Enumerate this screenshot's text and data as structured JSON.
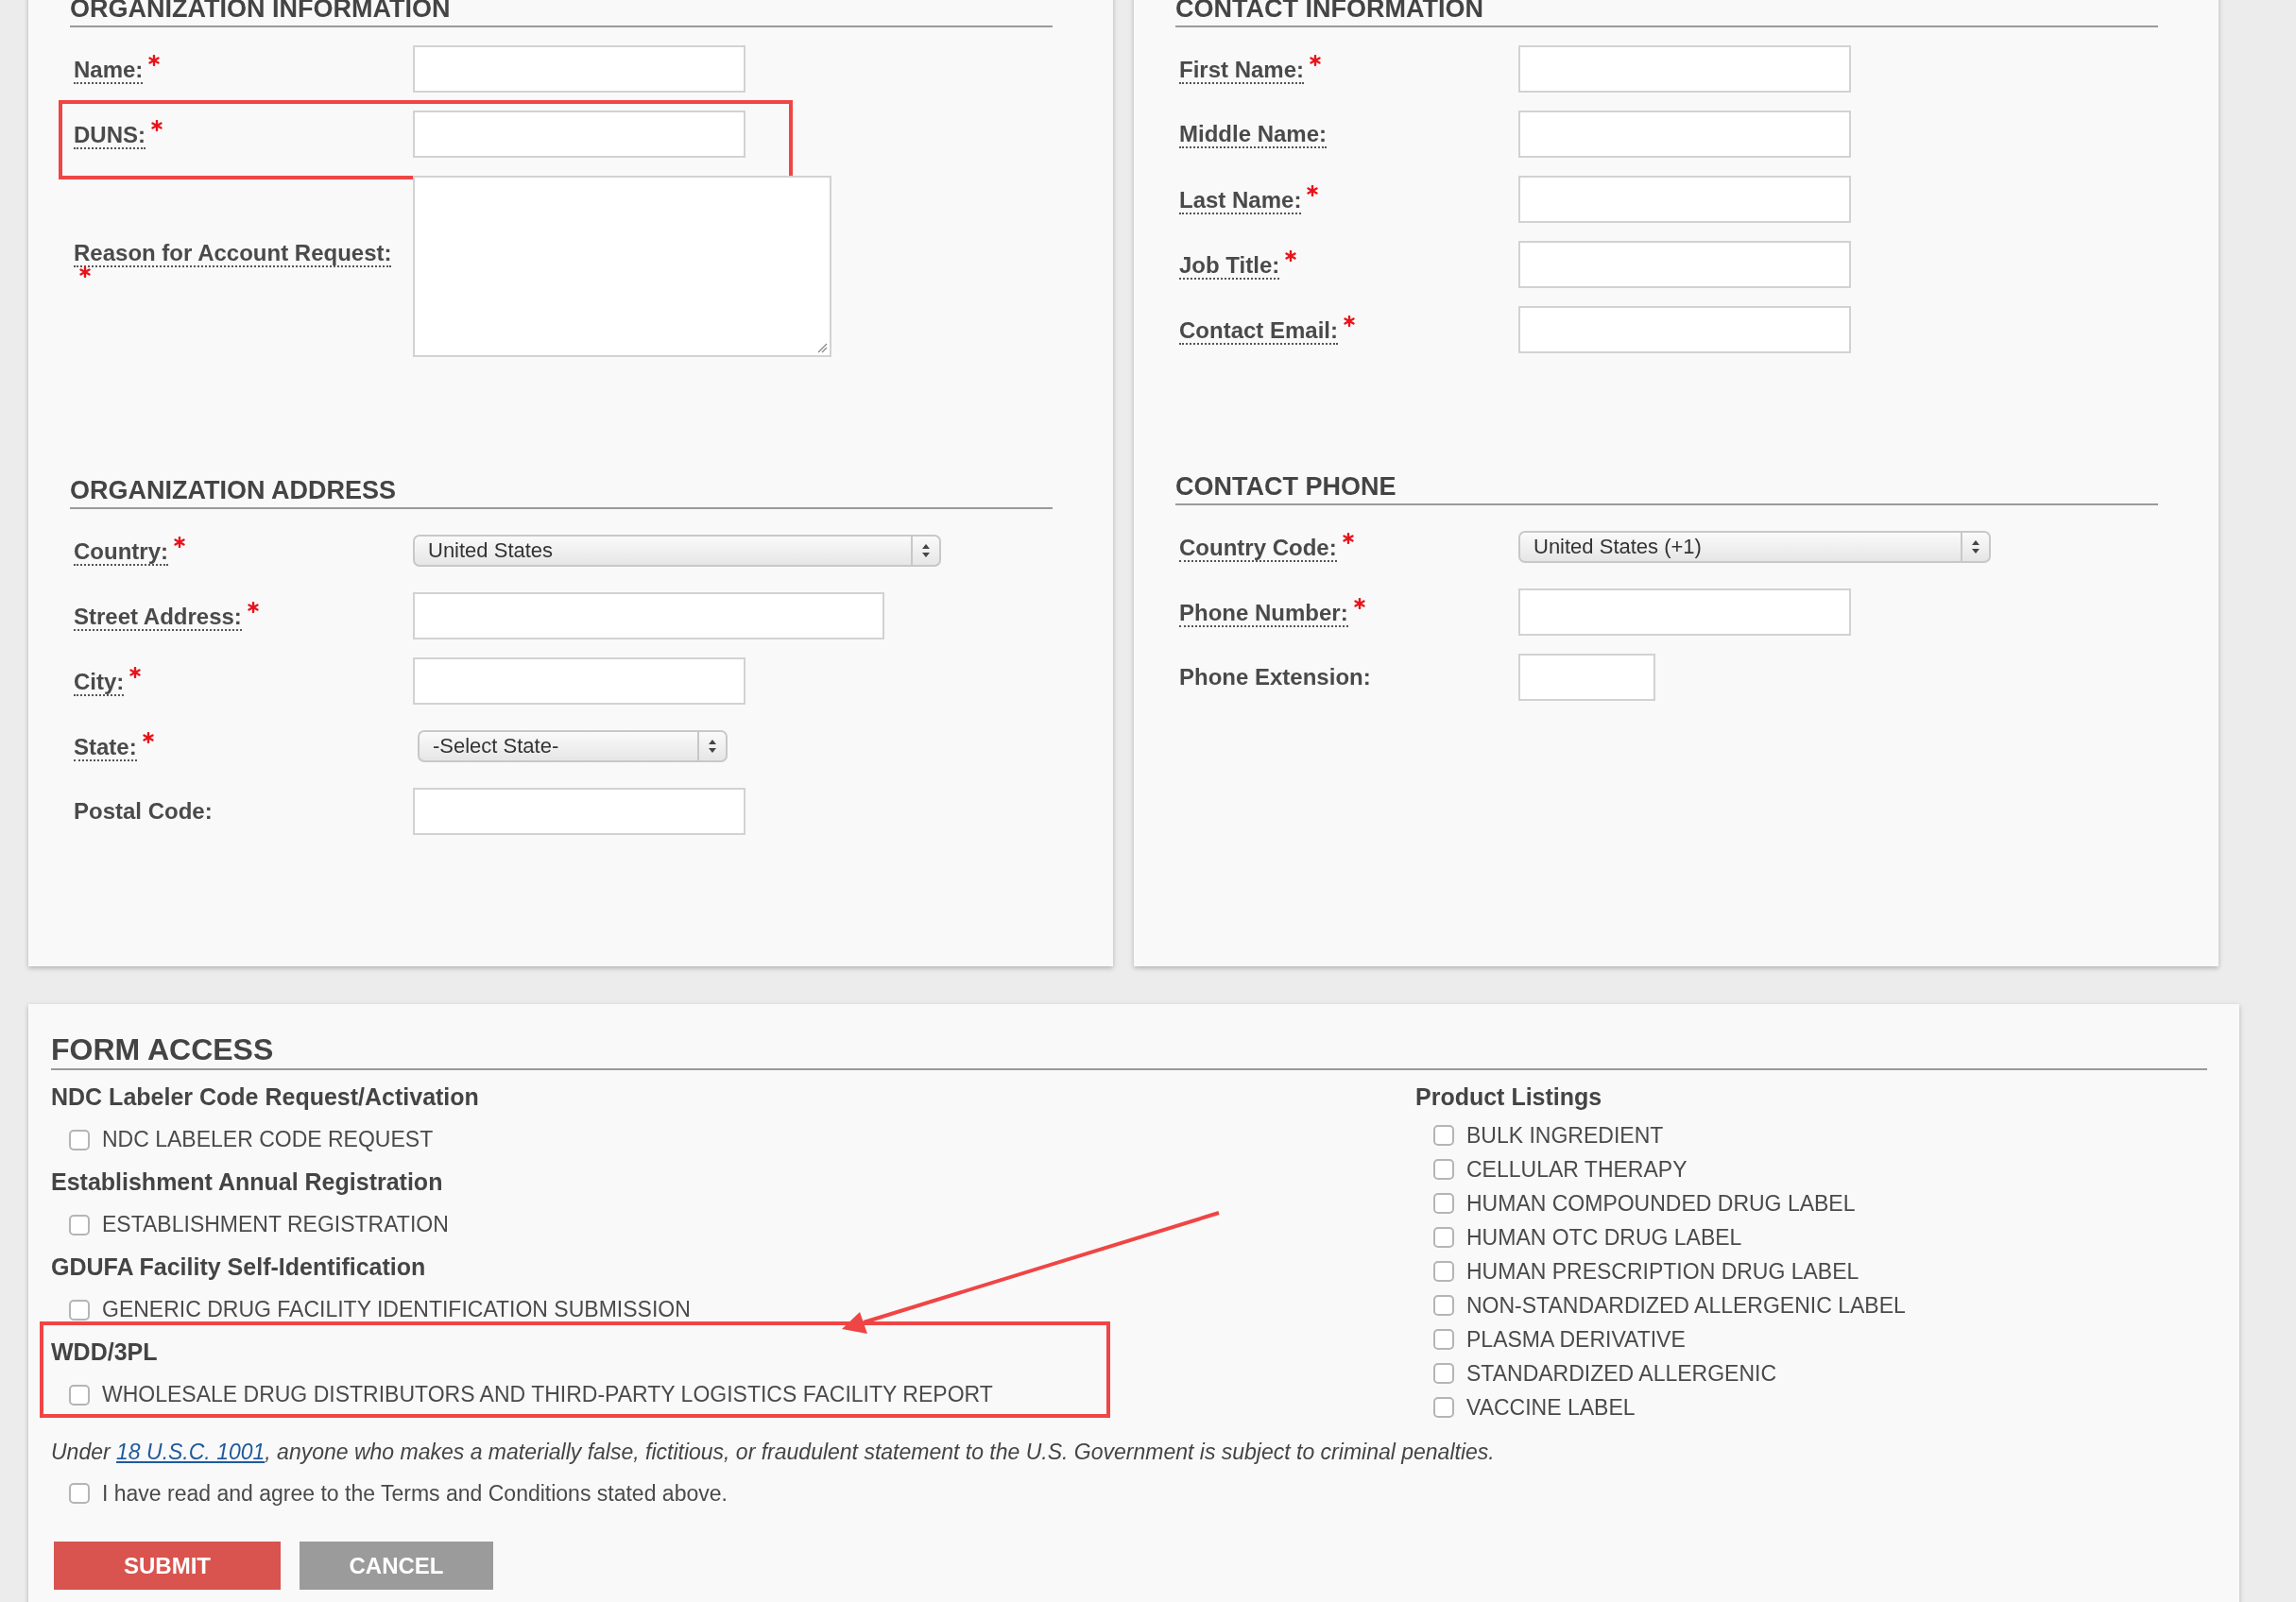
{
  "organization_information": {
    "heading": "ORGANIZATION INFORMATION",
    "fields": [
      {
        "label": "Name:",
        "required": true,
        "help": true,
        "kind": "text",
        "highlighted": false
      },
      {
        "label": "DUNS:",
        "required": true,
        "help": true,
        "kind": "text",
        "highlighted": true
      },
      {
        "label": "Reason for Account Request:",
        "required": true,
        "help": true,
        "kind": "textarea",
        "highlighted": false
      }
    ]
  },
  "organization_address": {
    "heading": "ORGANIZATION ADDRESS",
    "fields": [
      {
        "label": "Country:",
        "required": true,
        "help": true,
        "kind": "select",
        "value": "United States"
      },
      {
        "label": "Street Address:",
        "required": true,
        "help": true,
        "kind": "wide-text"
      },
      {
        "label": "City:",
        "required": true,
        "help": true,
        "kind": "text"
      },
      {
        "label": "State:",
        "required": true,
        "help": true,
        "kind": "short-select",
        "value": "-Select State-"
      },
      {
        "label": "Postal Code:",
        "required": false,
        "help": false,
        "kind": "text"
      }
    ]
  },
  "contact_information": {
    "heading": "CONTACT INFORMATION",
    "fields": [
      {
        "label": "First Name:",
        "required": true,
        "help": true,
        "kind": "text"
      },
      {
        "label": "Middle Name:",
        "required": false,
        "help": true,
        "kind": "text"
      },
      {
        "label": "Last Name:",
        "required": true,
        "help": true,
        "kind": "text"
      },
      {
        "label": "Job Title:",
        "required": true,
        "help": true,
        "kind": "text"
      },
      {
        "label": "Contact Email:",
        "required": true,
        "help": true,
        "kind": "text"
      }
    ]
  },
  "contact_phone": {
    "heading": "CONTACT PHONE",
    "fields": [
      {
        "label": "Country Code:",
        "required": true,
        "help": true,
        "kind": "medium-select",
        "value": "United States (+1)"
      },
      {
        "label": "Phone Number:",
        "required": true,
        "help": true,
        "kind": "text"
      },
      {
        "label": "Phone Extension:",
        "required": false,
        "help": false,
        "kind": "short-text"
      }
    ]
  },
  "form_access": {
    "heading": "FORM ACCESS",
    "groups": [
      {
        "title": "NDC Labeler Code Request/Activation",
        "highlighted": false,
        "options": [
          {
            "label": "NDC LABELER CODE REQUEST",
            "checked": false
          }
        ]
      },
      {
        "title": "Establishment Annual Registration",
        "highlighted": false,
        "options": [
          {
            "label": "ESTABLISHMENT REGISTRATION",
            "checked": false
          }
        ]
      },
      {
        "title": "GDUFA Facility Self-Identification",
        "highlighted": false,
        "options": [
          {
            "label": "GENERIC DRUG FACILITY IDENTIFICATION SUBMISSION",
            "checked": false
          }
        ]
      },
      {
        "title": "WDD/3PL",
        "highlighted": true,
        "options": [
          {
            "label": "WHOLESALE DRUG DISTRIBUTORS AND THIRD-PARTY LOGISTICS FACILITY REPORT",
            "checked": false
          }
        ]
      }
    ],
    "product_listings": {
      "title": "Product Listings",
      "options": [
        {
          "label": "BULK INGREDIENT",
          "checked": false
        },
        {
          "label": "CELLULAR THERAPY",
          "checked": false
        },
        {
          "label": "HUMAN COMPOUNDED DRUG LABEL",
          "checked": false
        },
        {
          "label": "HUMAN OTC DRUG LABEL",
          "checked": false
        },
        {
          "label": "HUMAN PRESCRIPTION DRUG LABEL",
          "checked": false
        },
        {
          "label": "NON-STANDARDIZED ALLERGENIC LABEL",
          "checked": false
        },
        {
          "label": "PLASMA DERIVATIVE",
          "checked": false
        },
        {
          "label": "STANDARDIZED ALLERGENIC",
          "checked": false
        },
        {
          "label": "VACCINE LABEL",
          "checked": false
        }
      ]
    },
    "statement": {
      "before": "Under ",
      "link": "18 U.S.C. 1001",
      "after": ", anyone who makes a materially false, fictitious, or fraudulent statement to the U.S. Government is subject to criminal penalties."
    },
    "agreement": {
      "label": "I have read and agree to the Terms and Conditions stated above.",
      "checked": false
    },
    "buttons": [
      {
        "label": "SUBMIT",
        "kind": "primary"
      },
      {
        "label": "CANCEL",
        "kind": "secondary"
      }
    ]
  }
}
